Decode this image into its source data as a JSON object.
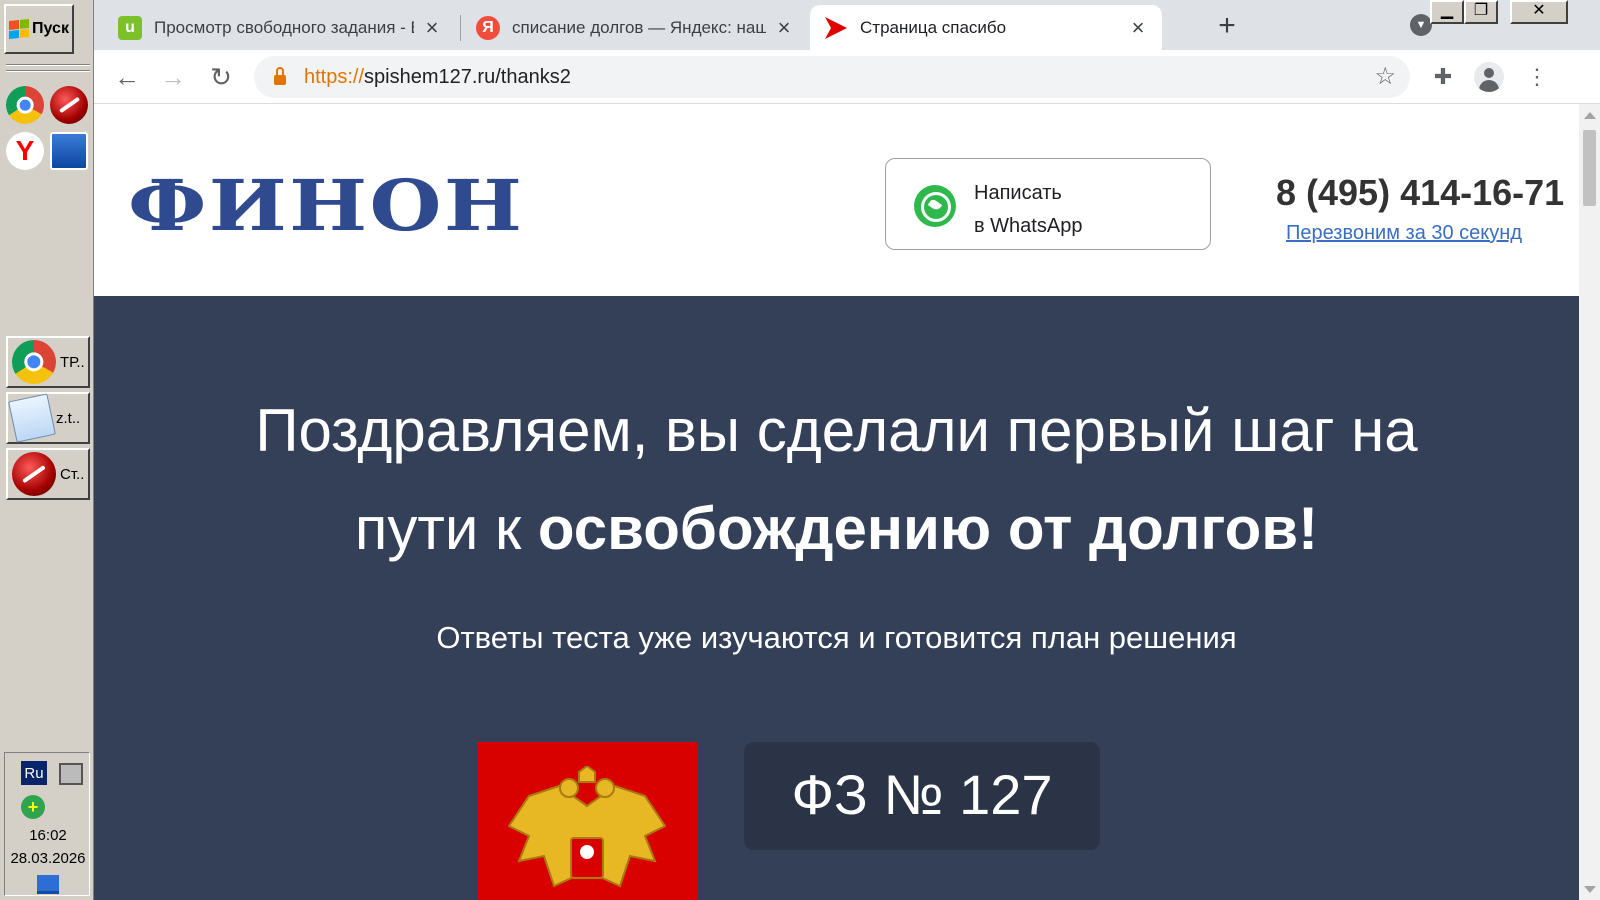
{
  "taskbar": {
    "start_label": "Пуск",
    "tasks": [
      {
        "label": "ТР.."
      },
      {
        "label": "z.t.."
      },
      {
        "label": "Ст.."
      }
    ],
    "tray": {
      "lang": "Ru",
      "time": "16:02",
      "date": "28.03.2026"
    }
  },
  "browser": {
    "tabs": [
      {
        "title": "Просмотр свободного задания - В",
        "favicon": "u",
        "favicon_color": "#7cc02b",
        "active": false
      },
      {
        "title": "списание долгов — Яндекс: нашло",
        "favicon": "Я",
        "favicon_color": "#f24c3d",
        "active": false
      },
      {
        "title": "Страница спасибо",
        "favicon": "arrow",
        "favicon_color": "#e00000",
        "active": true
      }
    ],
    "url_scheme": "https://",
    "url_rest": "spishem127.ru/thanks2"
  },
  "page": {
    "logo": "ФИНОН",
    "whatsapp_line1": "Написать",
    "whatsapp_line2": "в WhatsApp",
    "phone": "8 (495) 414-16-71",
    "callback_link": "Перезвоним за 30 секунд",
    "hero_title_line1": "Поздравляем, вы сделали первый шаг на",
    "hero_title_line2_plain": "пути к ",
    "hero_title_line2_bold": "освобождению от долгов!",
    "hero_subtitle": "Ответы теста уже изучаются и готовится план решения",
    "law_badge": "ФЗ № 127"
  },
  "colors": {
    "hero_bg": "#334058",
    "logo": "#2f4a8f",
    "link": "#3a6ec3",
    "emblem_bg": "#d90000"
  }
}
